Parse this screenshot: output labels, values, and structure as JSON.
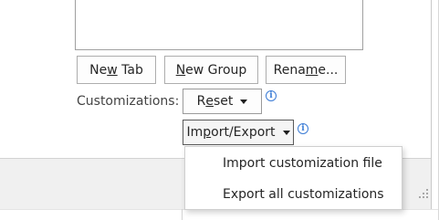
{
  "list_box": {},
  "buttons": {
    "new_tab_prefix": "Ne",
    "new_tab_mnemonic": "w",
    "new_tab_suffix": " Tab",
    "new_group_mnemonic": "N",
    "new_group_suffix": "ew Group",
    "rename_prefix": "Rena",
    "rename_mnemonic": "m",
    "rename_suffix": "e...",
    "reset_prefix": "R",
    "reset_mnemonic": "e",
    "reset_suffix": "set",
    "import_export_prefix": "Im",
    "import_export_mnemonic": "p",
    "import_export_suffix": "ort/Export"
  },
  "customizations_label": "Customizations:",
  "info_icon_glyph": "i",
  "menu": {
    "items": [
      "Import customization file",
      "Export all customizations"
    ]
  },
  "colors": {
    "info_accent": "#3a7bd5",
    "footer_bg": "#f0f0f0"
  },
  "icons": {
    "caret": "chevron-down-icon",
    "info": "info-icon",
    "grip": "resize-grip-icon"
  }
}
